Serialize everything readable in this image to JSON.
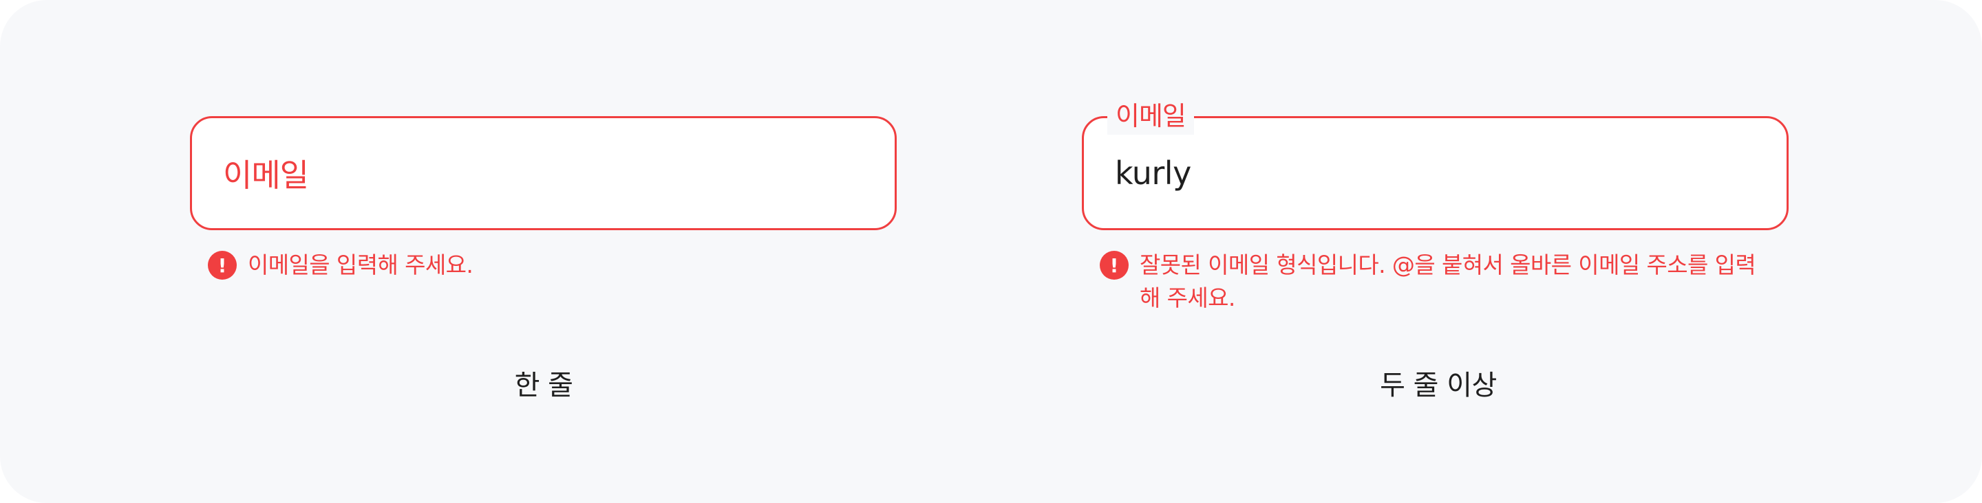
{
  "colors": {
    "background": "#f7f8fa",
    "error": "#f03f40",
    "text": "#1f1f1f",
    "field_bg": "#ffffff"
  },
  "single_line": {
    "placeholder": "이메일",
    "error_icon": "exclamation-icon",
    "error_message": "이메일을 입력해 주세요.",
    "caption": "한 줄"
  },
  "multi_line": {
    "label": "이메일",
    "value": "kurly",
    "error_icon": "exclamation-icon",
    "error_message": "잘못된 이메일 형식입니다. @을 붙혀서 올바른 이메일 주소를 입력해 주세요.",
    "caption": "두 줄 이상"
  }
}
